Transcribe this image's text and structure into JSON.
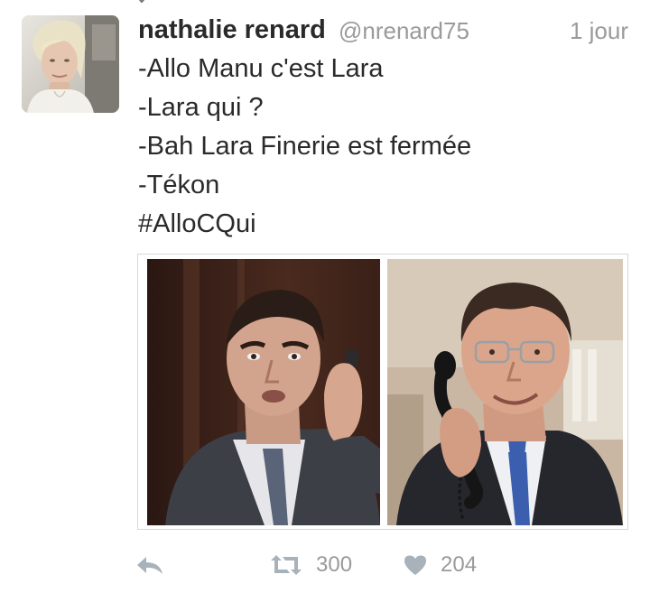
{
  "tweet": {
    "author": {
      "display_name": "nathalie renard",
      "handle": "@nrenard75"
    },
    "timestamp": "1 jour",
    "text_lines": [
      "-Allo Manu c'est Lara",
      "-Lara qui ?",
      "-Bah Lara Finerie est fermée",
      "-Tékon",
      "#AlloCQui"
    ],
    "media": {
      "images": [
        "photo-left",
        "photo-right"
      ]
    },
    "actions": {
      "reply_icon": "reply-icon",
      "retweet_icon": "retweet-icon",
      "retweet_count": "300",
      "like_icon": "heart-icon",
      "like_count": "204"
    }
  },
  "colors": {
    "text": "#2a2a2a",
    "muted": "#9a9a9a",
    "icon": "#a8b2bb",
    "border": "#d7d7d7"
  }
}
